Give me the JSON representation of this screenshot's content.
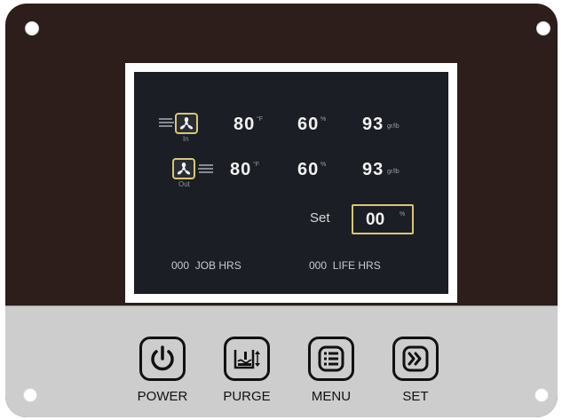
{
  "colors": {
    "housing": "#2d1d1b",
    "key_panel": "#cdcdcd",
    "screen": "#1b1e24",
    "highlight": "#d9c57a"
  },
  "display": {
    "row_in": {
      "fan_icon": "fan-icon",
      "caption": "In",
      "temperature": "80",
      "temperature_unit": "°F",
      "humidity": "60",
      "humidity_unit": "%",
      "grains": "93",
      "grains_unit": "gr/lb"
    },
    "row_out": {
      "fan_icon": "fan-icon",
      "caption": "Out",
      "temperature": "80",
      "temperature_unit": "°F",
      "humidity": "60",
      "humidity_unit": "%",
      "grains": "93",
      "grains_unit": "gr/lb"
    },
    "set": {
      "label": "Set",
      "value": "00",
      "unit": "%"
    },
    "job_hours": "000  JOB HRS",
    "life_hours": "000  LIFE HRS"
  },
  "buttons": [
    {
      "icon": "power-icon",
      "label": "POWER"
    },
    {
      "icon": "purge-icon",
      "label": "PURGE"
    },
    {
      "icon": "menu-icon",
      "label": "MENU"
    },
    {
      "icon": "double-chevron-right-icon",
      "label": "SET"
    }
  ]
}
